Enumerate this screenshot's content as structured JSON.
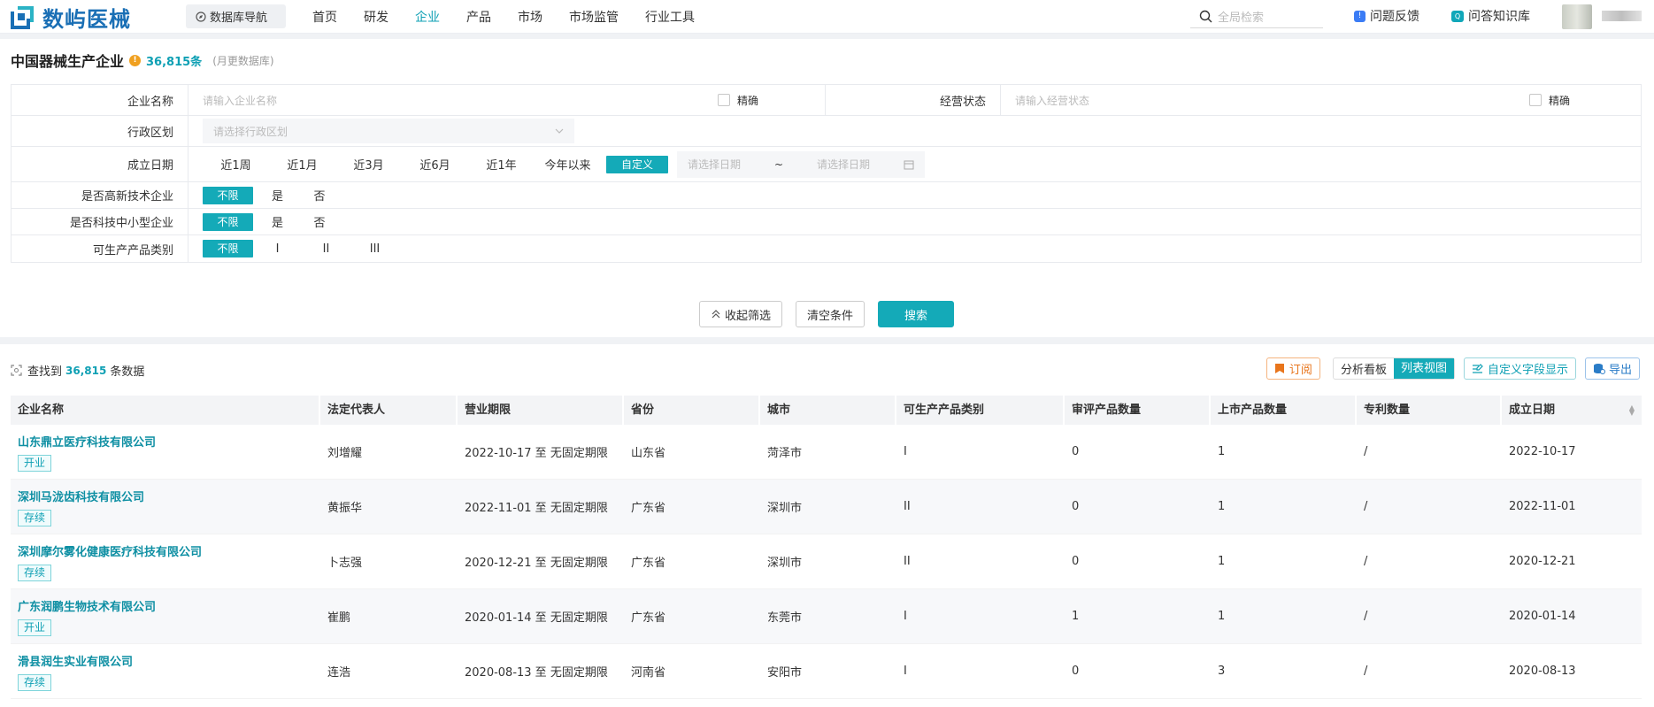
{
  "header": {
    "logo_text": "数屿医械",
    "db_nav": "数据库导航",
    "nav": [
      "首页",
      "研发",
      "企业",
      "产品",
      "市场",
      "市场监管",
      "行业工具"
    ],
    "active_nav": "企业",
    "search_placeholder": "全局检索",
    "feedback": "问题反馈",
    "knowledge_base": "问答知识库"
  },
  "page": {
    "title": "中国器械生产企业",
    "count": "36,815条",
    "note": "(月更数据库)"
  },
  "filters": {
    "company_name": {
      "label": "企业名称",
      "placeholder": "请输入企业名称",
      "exact": "精确"
    },
    "business_status": {
      "label": "经营状态",
      "placeholder": "请输入经营状态",
      "exact": "精确"
    },
    "region": {
      "label": "行政区划",
      "placeholder": "请选择行政区划"
    },
    "founded": {
      "label": "成立日期",
      "options": [
        "近1周",
        "近1月",
        "近3月",
        "近6月",
        "近1年",
        "今年以来"
      ],
      "active": "自定义",
      "start_placeholder": "请选择日期",
      "separator": "~",
      "end_placeholder": "请选择日期"
    },
    "high_tech": {
      "label": "是否高新技术企业",
      "active": "不限",
      "options": [
        "是",
        "否"
      ]
    },
    "sme": {
      "label": "是否科技中小型企业",
      "active": "不限",
      "options": [
        "是",
        "否"
      ]
    },
    "product_class": {
      "label": "可生产产品类别",
      "active": "不限",
      "options": [
        "I",
        "II",
        "III"
      ]
    }
  },
  "actions": {
    "collapse": "收起筛选",
    "clear": "清空条件",
    "search": "搜索"
  },
  "results": {
    "found_prefix": "查找到",
    "found_count": "36,815",
    "found_suffix": "条数据",
    "subscribe": "订阅",
    "analysis_board": "分析看板",
    "list_view": "列表视图",
    "custom_fields": "自定义字段显示",
    "export": "导出",
    "columns": [
      "企业名称",
      "法定代表人",
      "营业期限",
      "省份",
      "城市",
      "可生产产品类别",
      "审评产品数量",
      "上市产品数量",
      "专利数量",
      "成立日期"
    ],
    "rows": [
      {
        "name": "山东鼎立医疗科技有限公司",
        "status": "开业",
        "rep": "刘增耀",
        "term": "2022-10-17 至 无固定期限",
        "province": "山东省",
        "city": "菏泽市",
        "class": "I",
        "review": "0",
        "listed": "1",
        "patents": "/",
        "founded": "2022-10-17"
      },
      {
        "name": "深圳马泷齿科技有限公司",
        "status": "存续",
        "rep": "黄振华",
        "term": "2022-11-01 至 无固定期限",
        "province": "广东省",
        "city": "深圳市",
        "class": "II",
        "review": "0",
        "listed": "1",
        "patents": "/",
        "founded": "2022-11-01"
      },
      {
        "name": "深圳摩尔雾化健康医疗科技有限公司",
        "status": "存续",
        "rep": "卜志强",
        "term": "2020-12-21 至 无固定期限",
        "province": "广东省",
        "city": "深圳市",
        "class": "II",
        "review": "0",
        "listed": "1",
        "patents": "/",
        "founded": "2020-12-21"
      },
      {
        "name": "广东润鹏生物技术有限公司",
        "status": "开业",
        "rep": "崔鹏",
        "term": "2020-01-14 至 无固定期限",
        "province": "广东省",
        "city": "东莞市",
        "class": "I",
        "review": "1",
        "listed": "1",
        "patents": "/",
        "founded": "2020-01-14"
      },
      {
        "name": "滑县润生实业有限公司",
        "status": "存续",
        "rep": "连浩",
        "term": "2020-08-13 至 无固定期限",
        "province": "河南省",
        "city": "安阳市",
        "class": "I",
        "review": "0",
        "listed": "3",
        "patents": "/",
        "founded": "2020-08-13"
      }
    ]
  },
  "colors": {
    "accent": "#14aab8",
    "link": "#0e8fa3",
    "logo": "#1a6fb5"
  }
}
